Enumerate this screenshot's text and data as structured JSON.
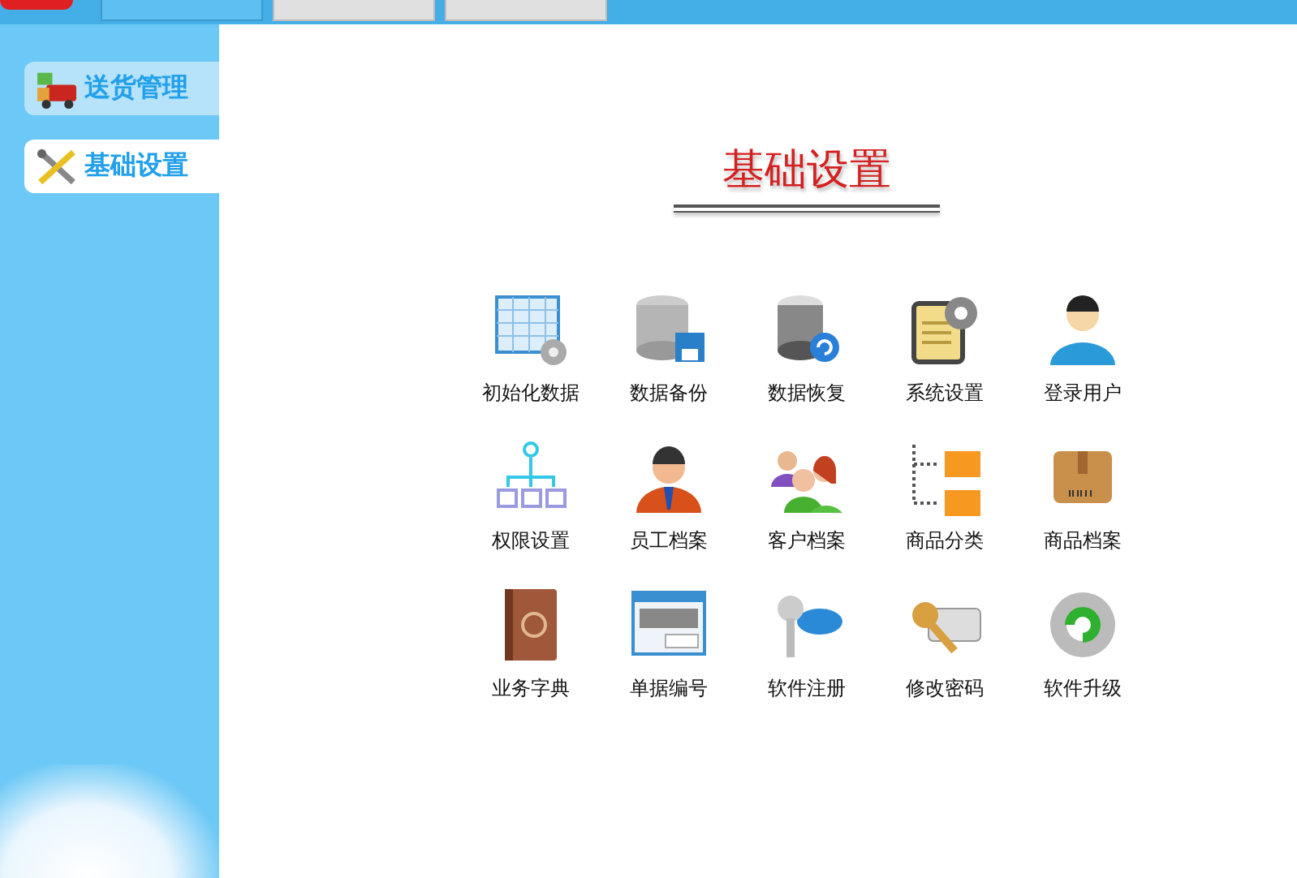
{
  "tabs": [
    {
      "selected": true
    },
    {
      "selected": false
    },
    {
      "selected": false
    }
  ],
  "sidebar": {
    "items": [
      {
        "label": "送货管理",
        "kind": "truck",
        "selected": false
      },
      {
        "label": "基础设置",
        "kind": "tools",
        "selected": true
      }
    ]
  },
  "heading": "基础设置",
  "functions": [
    {
      "label": "初始化数据",
      "kind": "table-gear"
    },
    {
      "label": "数据备份",
      "kind": "db-save"
    },
    {
      "label": "数据恢复",
      "kind": "db-restore"
    },
    {
      "label": "系统设置",
      "kind": "doc-gear"
    },
    {
      "label": "登录用户",
      "kind": "user"
    },
    {
      "label": "权限设置",
      "kind": "org"
    },
    {
      "label": "员工档案",
      "kind": "employee"
    },
    {
      "label": "客户档案",
      "kind": "people"
    },
    {
      "label": "商品分类",
      "kind": "folders"
    },
    {
      "label": "商品档案",
      "kind": "box"
    },
    {
      "label": "业务字典",
      "kind": "book"
    },
    {
      "label": "单据编号",
      "kind": "numbering"
    },
    {
      "label": "软件注册",
      "kind": "key-tag"
    },
    {
      "label": "修改密码",
      "kind": "key-password"
    },
    {
      "label": "软件升级",
      "kind": "gear-refresh"
    }
  ]
}
